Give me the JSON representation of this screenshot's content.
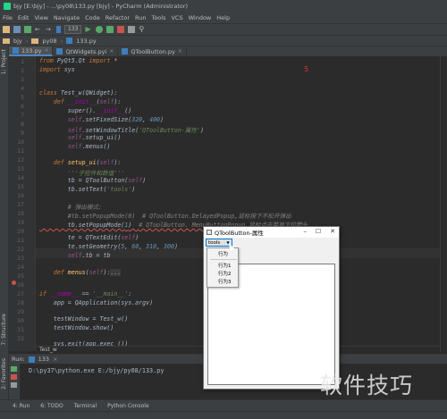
{
  "window_title": "bjy [E:\\bjy] - ...\\py08\\133.py [bjy] - PyCharm (Administrator)",
  "menu": [
    "File",
    "Edit",
    "View",
    "Navigate",
    "Code",
    "Refactor",
    "Run",
    "Tools",
    "VCS",
    "Window",
    "Help"
  ],
  "toolbar": {
    "run_config": "133"
  },
  "navbar": [
    "bjy",
    "py08",
    "133.py"
  ],
  "tabs": [
    {
      "label": "133.py",
      "active": true
    },
    {
      "label": "QtWidgets.pyi",
      "active": false
    },
    {
      "label": "QToolButton.py",
      "active": false
    }
  ],
  "side_labels": {
    "project": "1: Project",
    "structure": "7: Structure",
    "favorites": "2: Favorites"
  },
  "line_numbers": [
    "1",
    "2",
    "3",
    "4",
    "5",
    "6",
    "7",
    "8",
    "9",
    "10",
    "11",
    "12",
    "13",
    "14",
    "15",
    "16",
    "17",
    "18",
    "19",
    "20",
    "21",
    "22",
    "23",
    "24",
    "25",
    "26",
    "27",
    "28",
    "29",
    "30",
    "31",
    "32"
  ],
  "code_annotation": "5",
  "breadcrumb": "Test_w",
  "run": {
    "title": "Run:",
    "config": "133",
    "output": "D:\\py37\\python.exe E:/bjy/py08/133.py"
  },
  "bottom_tabs": [
    "4: Run",
    "6: TODO",
    "Terminal",
    "Python Console"
  ],
  "qt_window": {
    "title": "QToolButton-属性",
    "button_text": "tools",
    "menu_items": [
      "行为",
      "行为1",
      "行为2",
      "行为3"
    ]
  },
  "watermark": "软件技巧"
}
